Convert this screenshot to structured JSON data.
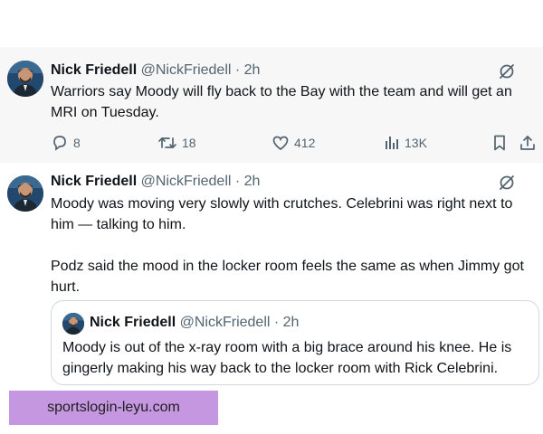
{
  "tweets": [
    {
      "author": "Nick Friedell",
      "handle": "@NickFriedell",
      "time": "2h",
      "lines": [
        "Warriors say Moody will fly back to the Bay with the team and will get an",
        "MRI on Tuesday."
      ],
      "replies": "8",
      "retweets": "18",
      "likes": "412",
      "views": "13K"
    },
    {
      "author": "Nick Friedell",
      "handle": "@NickFriedell",
      "time": "2h",
      "lines": [
        "Moody was moving very slowly with crutches. Celebrini was right next to",
        "him — talking to him.",
        "Podz said the mood in the locker room feels the same as when Jimmy got",
        "hurt."
      ],
      "quote": {
        "author": "Nick Friedell",
        "handle": "@NickFriedell",
        "time": "2h",
        "lines": [
          "Moody is out of the x-ray room with a big brace around his knee. He is",
          "gingerly making his way back to the locker room with Rick Celebrini."
        ]
      }
    }
  ],
  "separator": "·",
  "watermark": "sportslogin-leyu.com",
  "icons": {
    "reply": "reply-icon",
    "retweet": "retweet-icon",
    "like": "like-icon",
    "views": "views-icon",
    "bookmark": "bookmark-icon",
    "share": "share-icon",
    "grok": "grok-icon"
  },
  "colors": {
    "text": "#0f1419",
    "muted": "#536471",
    "highlight_bg": "#f7f7f7",
    "border": "#cfd9de",
    "watermark_bg": "#c497e0"
  }
}
